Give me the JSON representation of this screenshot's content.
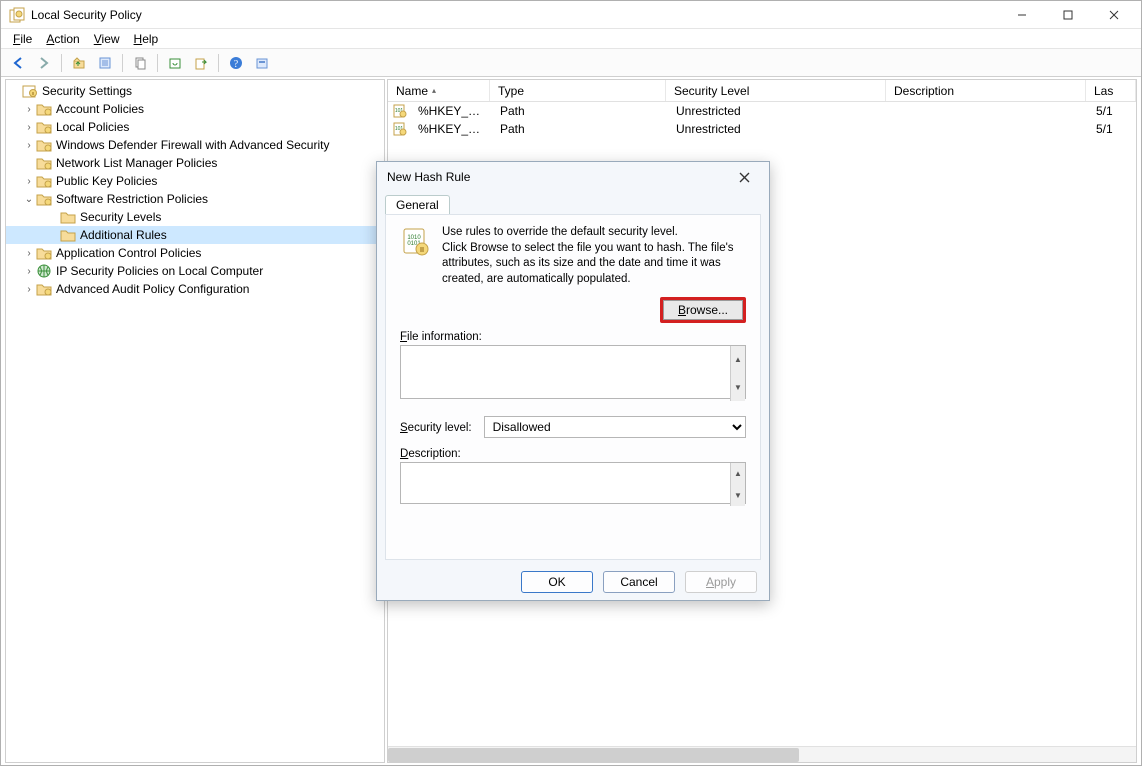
{
  "window": {
    "title": "Local Security Policy"
  },
  "menu": {
    "file": "File",
    "action": "Action",
    "view": "View",
    "help": "Help"
  },
  "toolbar": {
    "back": "back",
    "forward": "forward",
    "up": "up",
    "props": "properties",
    "copy": "copy",
    "refresh": "refresh",
    "export": "export",
    "help": "help",
    "extra": "options"
  },
  "tree": {
    "root": "Security Settings",
    "items": [
      {
        "label": "Account Policies",
        "expander": ">"
      },
      {
        "label": "Local Policies",
        "expander": ">"
      },
      {
        "label": "Windows Defender Firewall with Advanced Security",
        "expander": ">"
      },
      {
        "label": "Network List Manager Policies",
        "expander": ""
      },
      {
        "label": "Public Key Policies",
        "expander": ">"
      },
      {
        "label": "Software Restriction Policies",
        "expander": "v",
        "children": [
          {
            "label": "Security Levels"
          },
          {
            "label": "Additional Rules",
            "selected": true
          }
        ]
      },
      {
        "label": "Application Control Policies",
        "expander": ">"
      },
      {
        "label": "IP Security Policies on Local Computer",
        "expander": ">",
        "icon": "globe"
      },
      {
        "label": "Advanced Audit Policy Configuration",
        "expander": ">"
      }
    ]
  },
  "list": {
    "columns": {
      "name": "Name",
      "type": "Type",
      "security": "Security Level",
      "description": "Description",
      "last": "Las"
    },
    "rows": [
      {
        "name": "%HKEY_LOC...",
        "type": "Path",
        "security": "Unrestricted",
        "desc": "",
        "last": "5/1"
      },
      {
        "name": "%HKEY_LOC...",
        "type": "Path",
        "security": "Unrestricted",
        "desc": "",
        "last": "5/1"
      }
    ]
  },
  "dialog": {
    "title": "New Hash Rule",
    "tab": "General",
    "info1": "Use rules to override the default security level.",
    "info2": "Click Browse to select the file you want to hash. The file's attributes, such as its size and the date and time it was created, are automatically populated.",
    "browse": "Browse...",
    "file_info_label": "File information:",
    "file_info_value": "",
    "security_level_label": "Security level:",
    "security_level_value": "Disallowed",
    "description_label": "Description:",
    "description_value": "",
    "ok": "OK",
    "cancel": "Cancel",
    "apply": "Apply"
  }
}
